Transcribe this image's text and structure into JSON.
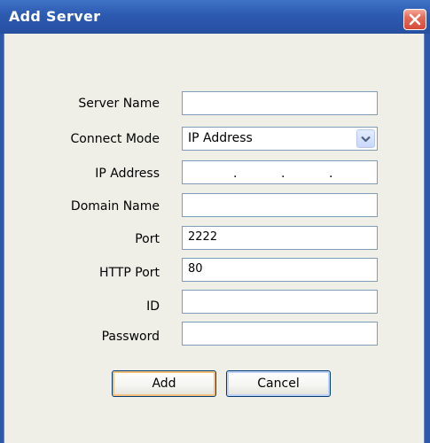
{
  "dialog": {
    "title": "Add Server",
    "close_icon": "close-icon",
    "accent_color": "#2c5ab1",
    "close_color": "#e46a57"
  },
  "form": {
    "server_name": {
      "label": "Server Name",
      "value": ""
    },
    "connect_mode": {
      "label": "Connect Mode",
      "value": "IP Address",
      "icon": "chevron-down-icon"
    },
    "ip_address": {
      "label": "IP Address",
      "value": "",
      "separator": "."
    },
    "domain_name": {
      "label": "Domain Name",
      "value": ""
    },
    "port": {
      "label": "Port",
      "value": "2222"
    },
    "http_port": {
      "label": "HTTP Port",
      "value": "80"
    },
    "id": {
      "label": "ID",
      "value": ""
    },
    "password": {
      "label": "Password",
      "value": ""
    }
  },
  "buttons": {
    "add_label": "Add",
    "cancel_label": "Cancel"
  }
}
